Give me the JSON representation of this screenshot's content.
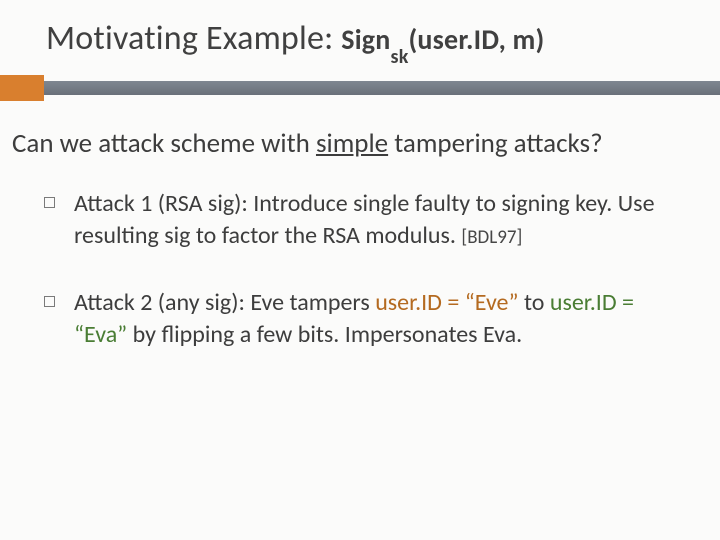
{
  "title": {
    "main": "Motivating Example:",
    "fn": "Sign",
    "sub": "sk",
    "args": "(user.ID, m)"
  },
  "question": {
    "pre": "Can we attack scheme with ",
    "underlined": "simple",
    "post": " tampering attacks?"
  },
  "bullets": [
    {
      "text": "Attack 1 (RSA sig): Introduce single faulty to signing key. Use resulting sig to factor the RSA modulus. ",
      "cite": "[BDL97]"
    },
    {
      "pre": "Attack 2 (any sig): Eve tampers ",
      "eve": "user.ID = “Eve”",
      "mid": " to ",
      "eva": "user.ID = “Eva”",
      "post": " by flipping a few bits. Impersonates Eva."
    }
  ]
}
